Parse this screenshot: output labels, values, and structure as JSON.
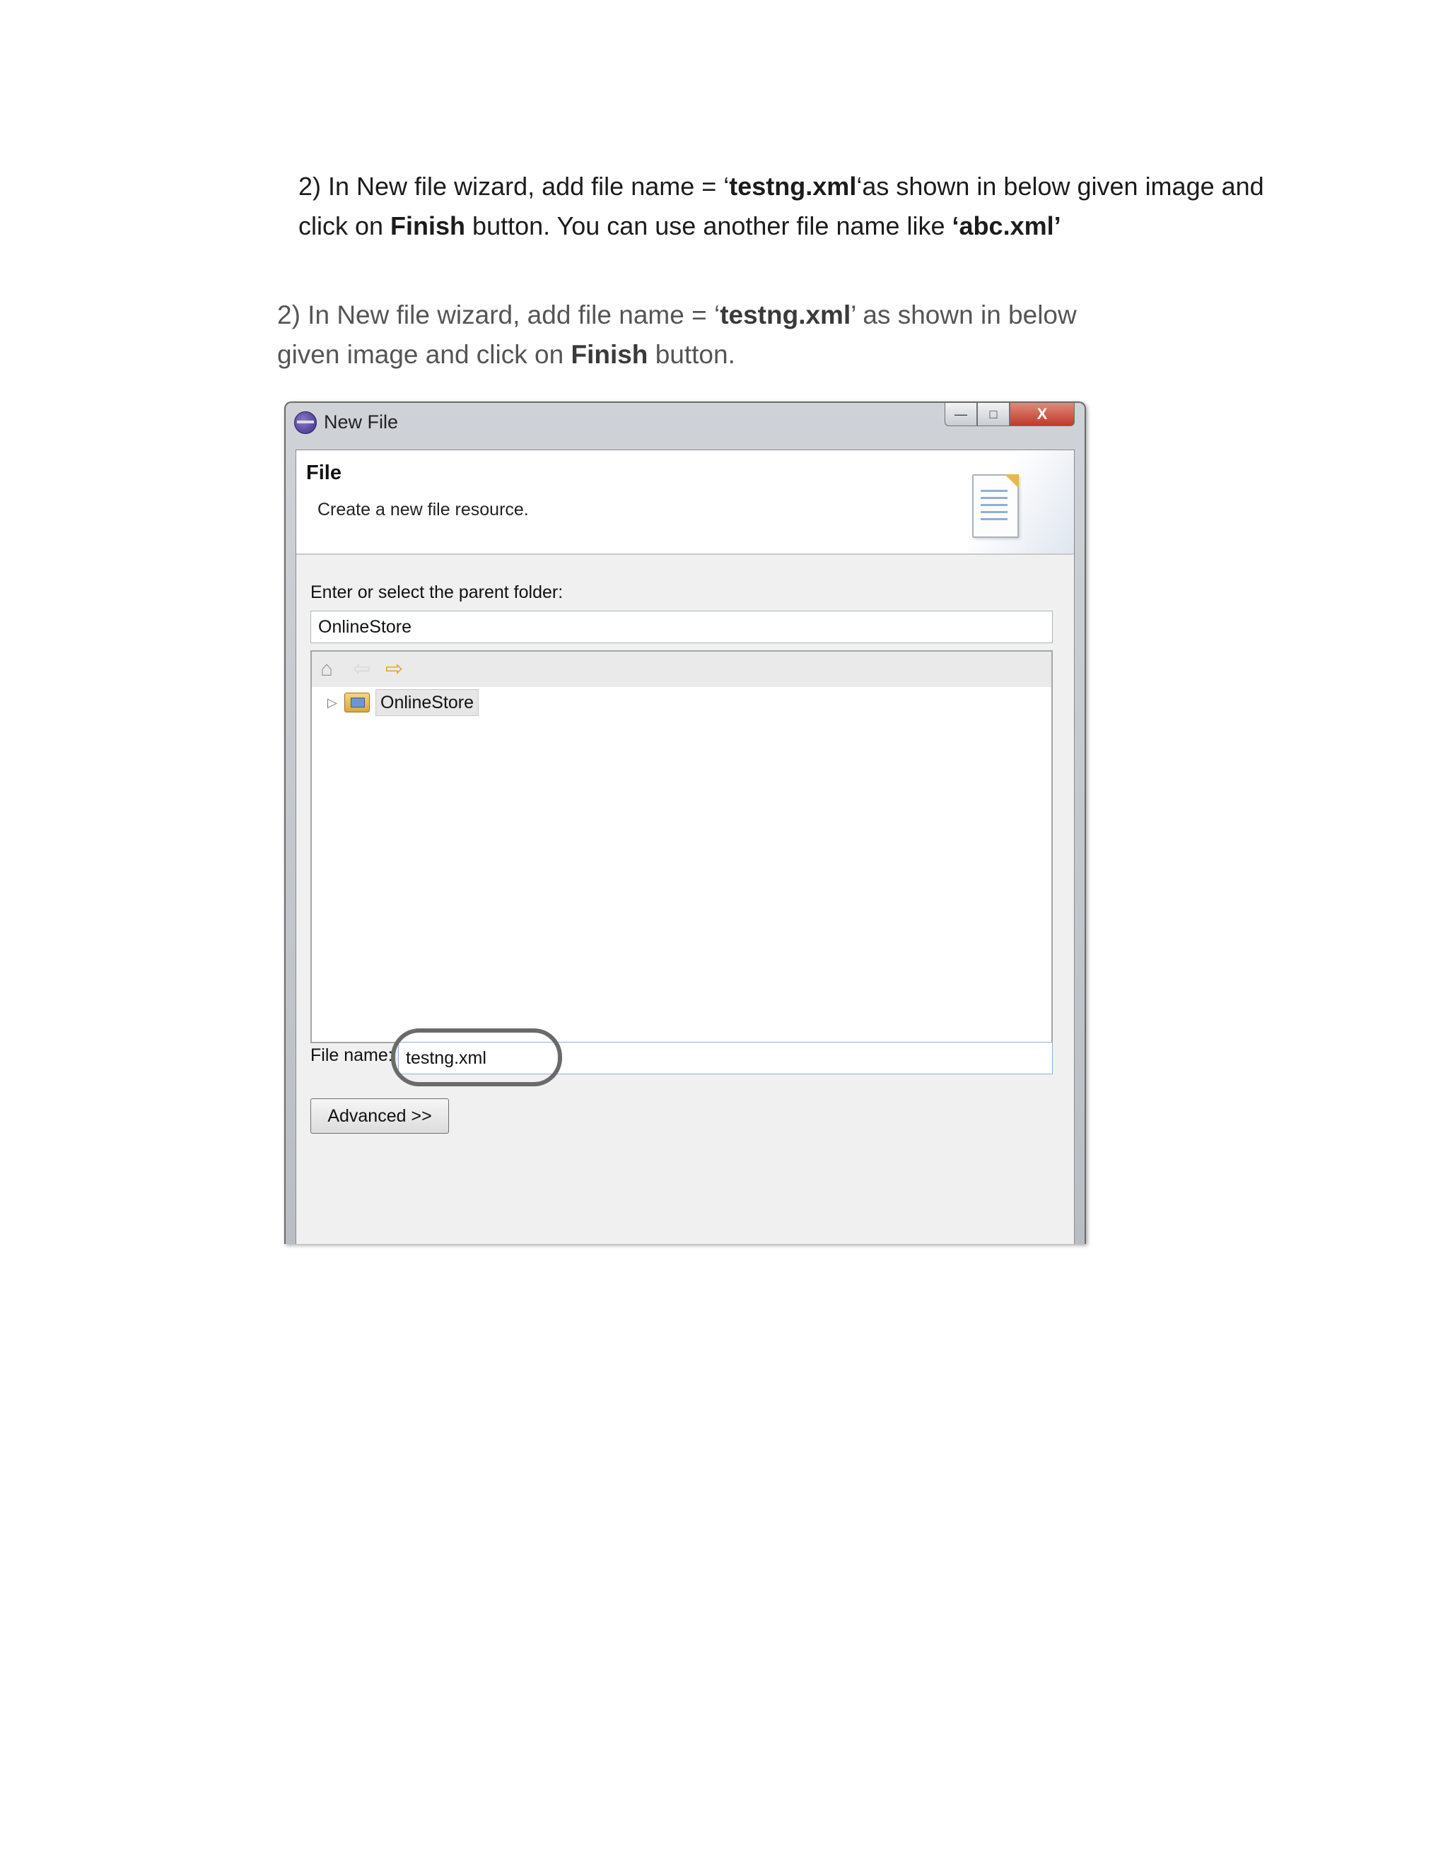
{
  "paragraph": {
    "p1": "2) In New file wizard, add file name = ‘",
    "p2": "testng.xml",
    "p3": "‘as shown in below given image and click on ",
    "p4": "Finish",
    "p5": " button.  You can use another file name like ",
    "p6": "‘abc.xml’"
  },
  "screenshot": {
    "caption": {
      "c1": "2) In New file wizard, add file name = ‘",
      "c2": "testng.xml",
      "c3": "’ as shown in below given image and click on ",
      "c4": "Finish",
      "c5": " button."
    },
    "window": {
      "title": "New File",
      "buttons": {
        "minimize": "—",
        "maximize": "□",
        "close": "X"
      },
      "header_title": "File",
      "header_description": "Create a new file resource.",
      "parent_folder_label": "Enter or select the parent folder:",
      "parent_folder_value": "OnlineStore",
      "tree": {
        "toolbar_icons": [
          "home-icon",
          "back-arrow-icon",
          "forward-arrow-icon"
        ],
        "items": [
          {
            "label": "OnlineStore",
            "icon": "project-folder-icon",
            "expander": "▷"
          }
        ]
      },
      "file_name_label": "File name:",
      "file_name_value": "testng.xml",
      "advanced_button": "Advanced >>"
    }
  }
}
